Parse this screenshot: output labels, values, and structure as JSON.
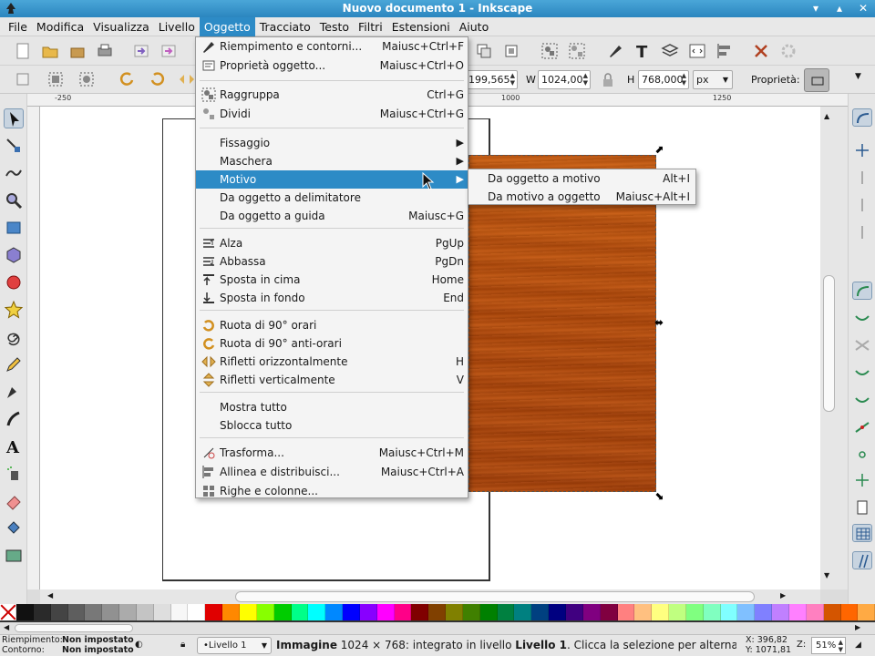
{
  "window": {
    "title": "Nuovo documento 1 - Inkscape"
  },
  "menubar": {
    "items": [
      "File",
      "Modifica",
      "Visualizza",
      "Livello",
      "Oggetto",
      "Tracciato",
      "Testo",
      "Filtri",
      "Estensioni",
      "Aiuto"
    ],
    "active_index": 4
  },
  "toolbar": {
    "x_value": "199,565",
    "w_label": "W",
    "w_value": "1024,00",
    "h_label": "H",
    "h_value": "768,000",
    "unit": "px",
    "properties_label": "Proprietà:"
  },
  "ruler": {
    "labels": [
      "-250",
      "1000",
      "1250"
    ]
  },
  "menu_oggetto": {
    "items": [
      {
        "label": "Riempimento e contorni...",
        "shortcut": "Maiusc+Ctrl+F",
        "icon": "fill-stroke-icon"
      },
      {
        "label": "Proprietà oggetto...",
        "shortcut": "Maiusc+Ctrl+O",
        "icon": "object-properties-icon"
      },
      {
        "label": "Raggruppa",
        "shortcut": "Ctrl+G",
        "icon": "group-icon"
      },
      {
        "label": "Dividi",
        "shortcut": "Maiusc+Ctrl+G",
        "icon": "ungroup-icon"
      },
      {
        "label": "Fissaggio",
        "shortcut": "",
        "icon": ""
      },
      {
        "label": "Maschera",
        "shortcut": "",
        "icon": ""
      },
      {
        "label": "Motivo",
        "shortcut": "",
        "icon": ""
      },
      {
        "label": "Da oggetto a delimitatore",
        "shortcut": "",
        "icon": ""
      },
      {
        "label": "Da oggetto a guida",
        "shortcut": "Maiusc+G",
        "icon": ""
      },
      {
        "label": "Alza",
        "shortcut": "PgUp",
        "icon": "raise-icon"
      },
      {
        "label": "Abbassa",
        "shortcut": "PgDn",
        "icon": "lower-icon"
      },
      {
        "label": "Sposta in cima",
        "shortcut": "Home",
        "icon": "raise-to-top-icon"
      },
      {
        "label": "Sposta in fondo",
        "shortcut": "End",
        "icon": "lower-to-bottom-icon"
      },
      {
        "label": "Ruota di 90° orari",
        "shortcut": "",
        "icon": "rotate-cw-icon"
      },
      {
        "label": "Ruota di 90° anti-orari",
        "shortcut": "",
        "icon": "rotate-ccw-icon"
      },
      {
        "label": "Rifletti orizzontalmente",
        "shortcut": "H",
        "icon": "flip-horizontal-icon"
      },
      {
        "label": "Rifletti verticalmente",
        "shortcut": "V",
        "icon": "flip-vertical-icon"
      },
      {
        "label": "Mostra tutto",
        "shortcut": "",
        "icon": ""
      },
      {
        "label": "Sblocca tutto",
        "shortcut": "",
        "icon": ""
      },
      {
        "label": "Trasforma...",
        "shortcut": "Maiusc+Ctrl+M",
        "icon": "transform-icon"
      },
      {
        "label": "Allinea e distribuisci...",
        "shortcut": "Maiusc+Ctrl+A",
        "icon": "align-distribute-icon"
      },
      {
        "label": "Righe e colonne...",
        "shortcut": "",
        "icon": "rows-columns-icon"
      }
    ],
    "highlighted": "Motivo"
  },
  "submenu_motivo": {
    "items": [
      {
        "label": "Da oggetto a motivo",
        "shortcut": "Alt+I"
      },
      {
        "label": "Da motivo a oggetto",
        "shortcut": "Maiusc+Alt+I"
      }
    ]
  },
  "status": {
    "fill_label": "Riempimento:",
    "fill_value": "Non impostato",
    "stroke_label": "Contorno:",
    "stroke_value": "Non impostato",
    "layer": "•Livello 1",
    "message_bold": "Immagine",
    "message_rest": " 1024 × 768: integrato in livello ",
    "message_layer": "Livello 1",
    "message_tail": ". Clicca la selezione per alternare le ...",
    "x_coord": "X: 396,82",
    "y_coord": "Y: 1071,81",
    "zoom_label": "Z:",
    "zoom": "51%"
  },
  "palette": [
    "#111111",
    "#2a2a2a",
    "#444444",
    "#5e5e5e",
    "#787878",
    "#919191",
    "#ababab",
    "#c4c4c4",
    "#dedede",
    "#f7f7f7",
    "#ffffff",
    "#e00000",
    "#ff8800",
    "#ffff00",
    "#88ff00",
    "#00cc00",
    "#00ff88",
    "#00ffff",
    "#0088ff",
    "#0000ff",
    "#8800ff",
    "#ff00ff",
    "#ff0088",
    "#800000",
    "#804000",
    "#808000",
    "#408000",
    "#008000",
    "#008040",
    "#008080",
    "#004080",
    "#000080",
    "#400080",
    "#800080",
    "#800040",
    "#ff8080",
    "#ffc080",
    "#ffff80",
    "#c0ff80",
    "#80ff80",
    "#80ffc0",
    "#80ffff",
    "#80c0ff",
    "#8080ff",
    "#c080ff",
    "#ff80ff",
    "#ff80c0",
    "#d45500",
    "#ff6600",
    "#ffaa44"
  ]
}
